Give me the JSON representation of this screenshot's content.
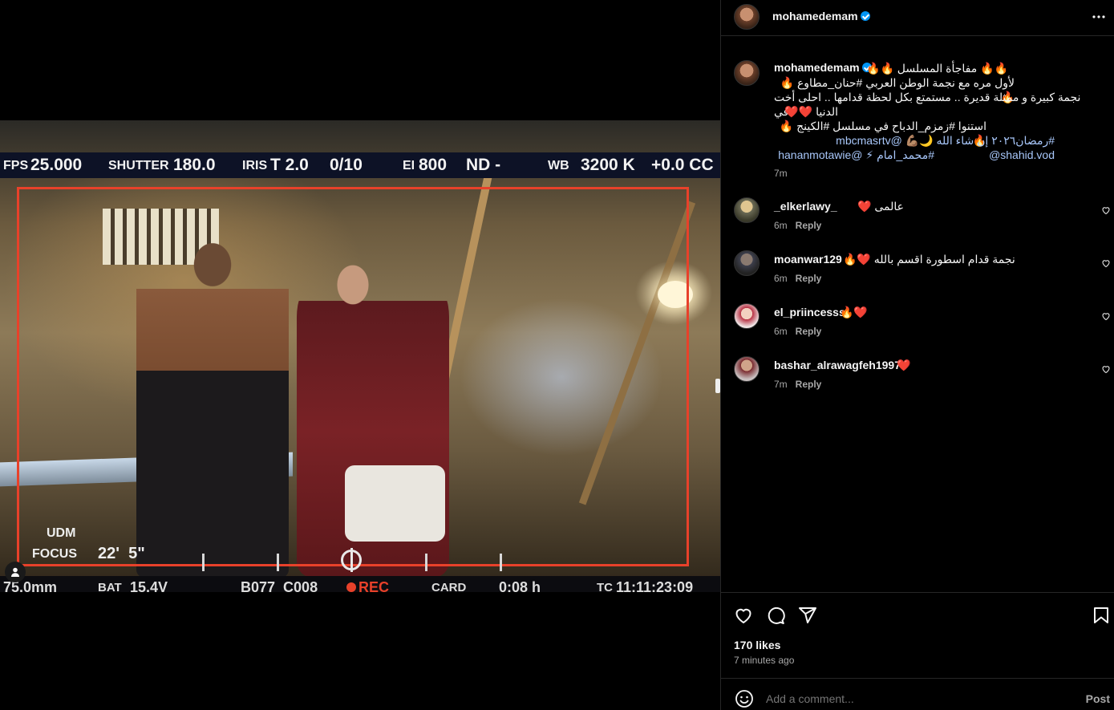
{
  "media": {
    "hud_top": {
      "fps_label": "FPS",
      "fps_value": "25.000",
      "shutter_label": "SHUTTER",
      "shutter_value": "180.0",
      "iris_label": "IRIS",
      "iris_value": "T 2.0",
      "iris_extra": "0/10",
      "ei_label": "EI",
      "ei_value": "800",
      "nd": "ND -",
      "wb_label": "WB",
      "wb_value": "3200 K",
      "cc": "+0.0 CC"
    },
    "hud_left": {
      "udm": "UDM",
      "focus_label": "FOCUS",
      "focus_value": "22'  5\""
    },
    "hud_bottom": {
      "lens": "75.0mm",
      "bat_label": "BAT",
      "bat_value": "15.4V",
      "clip": "B077_C008",
      "rec": "REC",
      "card_label": "CARD",
      "card_value": "0:08 h",
      "tc_label": "TC",
      "tc_value": "11:11:23:09"
    }
  },
  "post": {
    "username": "mohamedemam",
    "caption_lines": [
      "🔥🔥 مفاجأة المسلسل 🔥🔥",
      "لأول مره مع نجمة الوطن العربي #حنان_مطاوع 🔥🔥",
      "نجمة كبيرة و ممثلة قديرة .. مستمتع بكل لحظة قدامها .. احلى أخت في",
      "الدنيا ❤️❤️",
      "استنوا #زمزم_الدباح في مسلسل #الكينج 🔥🔥",
      "#رمضان٢٠٢٦ إن شاء الله 🌙💪🏽 @mbcmasrtv @shahid.vod",
      "#محمد_امام ⚡ @hananmotawie"
    ],
    "caption_time": "7m",
    "comments": [
      {
        "user": "_elkerlawy_",
        "text": "عالمى ❤️",
        "time": "6m",
        "reply": "Reply"
      },
      {
        "user": "moanwar129",
        "text": "نجمة قدام اسطورة اقسم بالله ❤️🔥",
        "time": "6m",
        "reply": "Reply"
      },
      {
        "user": "el_priincesss",
        "text": "🔥❤️",
        "time": "6m",
        "reply": "Reply"
      },
      {
        "user": "bashar_alrawagfeh1997",
        "text": "❤️",
        "time": "7m",
        "reply": "Reply"
      }
    ],
    "likes": "170 likes",
    "posted": "7 minutes ago",
    "add_comment_placeholder": "Add a comment...",
    "post_label": "Post"
  },
  "colors": {
    "accent": "#0095f6",
    "frameline": "#e8412a",
    "heart": "#ff3040"
  }
}
